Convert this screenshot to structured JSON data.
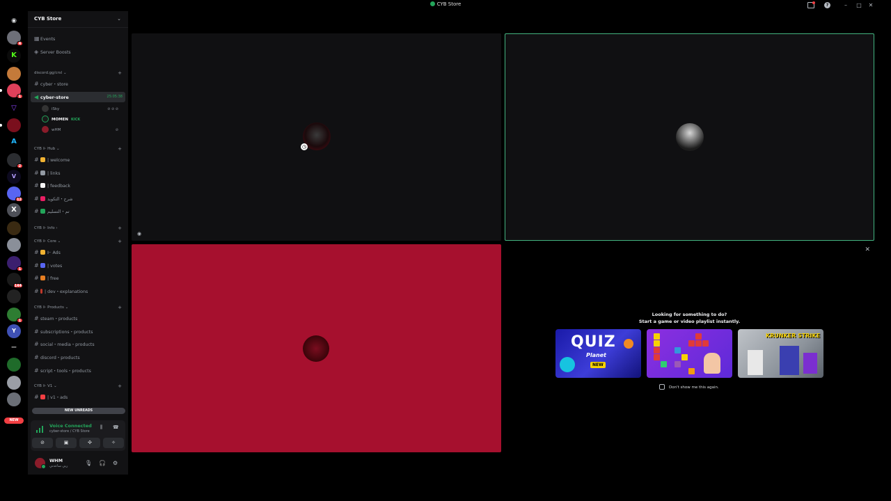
{
  "window": {
    "title": "CYB Store"
  },
  "guilds": {
    "new_pill": "NEW"
  },
  "server": {
    "name": "CYB Store"
  },
  "sidebar": {
    "top_items": [
      "Events",
      "Server Boosts"
    ],
    "categories": {
      "invite": "discord.gg/crsl",
      "hub": "CYB ⊩ Hub",
      "info": "CYB ⊩ Info",
      "core": "CYB ⊩ Core",
      "products": "CYB ⊩ Products",
      "v1": "CYB ⊩ V1"
    },
    "channels": {
      "cyber_store_text": "cyber・store",
      "cyber_store_voice": "cyber-store",
      "voice_time": "25:05:38",
      "welcome": "| welcome",
      "links": "| links",
      "feedback": "| feedback",
      "rules_ar": "شرح・التكويد",
      "accept_ar": "تم・التسليم",
      "ads": "⊩ Ads",
      "votes": "| votes",
      "free": "| free",
      "dev": "| dev・explanations",
      "steam": "steam・products",
      "subs": "subscriptions・products",
      "social": "social・media・products",
      "discord": "discord・products",
      "script": "script・tools・products",
      "v1ads": "| v1・ads"
    },
    "voice_users": [
      {
        "name": "iSky"
      },
      {
        "name": "MOMEN",
        "tag": "KICK"
      },
      {
        "name": "wHM"
      }
    ],
    "new_unreads": "NEW UNREADS"
  },
  "voice_panel": {
    "status": "Voice Connected",
    "location": "cyber-store / CYB Store"
  },
  "user_panel": {
    "name": "WHM",
    "status": "ربي ساعدني"
  },
  "activity": {
    "prompt_line1": "Looking for something to do?",
    "prompt_line2": "Start a game or video playlist instantly.",
    "cards": [
      {
        "name": "quiz-planet",
        "title": "QUIZ",
        "subtitle": "Planet",
        "badge": "NEW"
      },
      {
        "name": "blocks"
      },
      {
        "name": "krunker-strike",
        "title": "KRUNKER STRIKE"
      }
    ],
    "dont_show": "Don't show me this again."
  },
  "colors": {
    "accent_green": "#23a55a",
    "tile_red": "#a6102e",
    "speaking_border": "#43b581",
    "sidebar_bg": "#121214"
  }
}
